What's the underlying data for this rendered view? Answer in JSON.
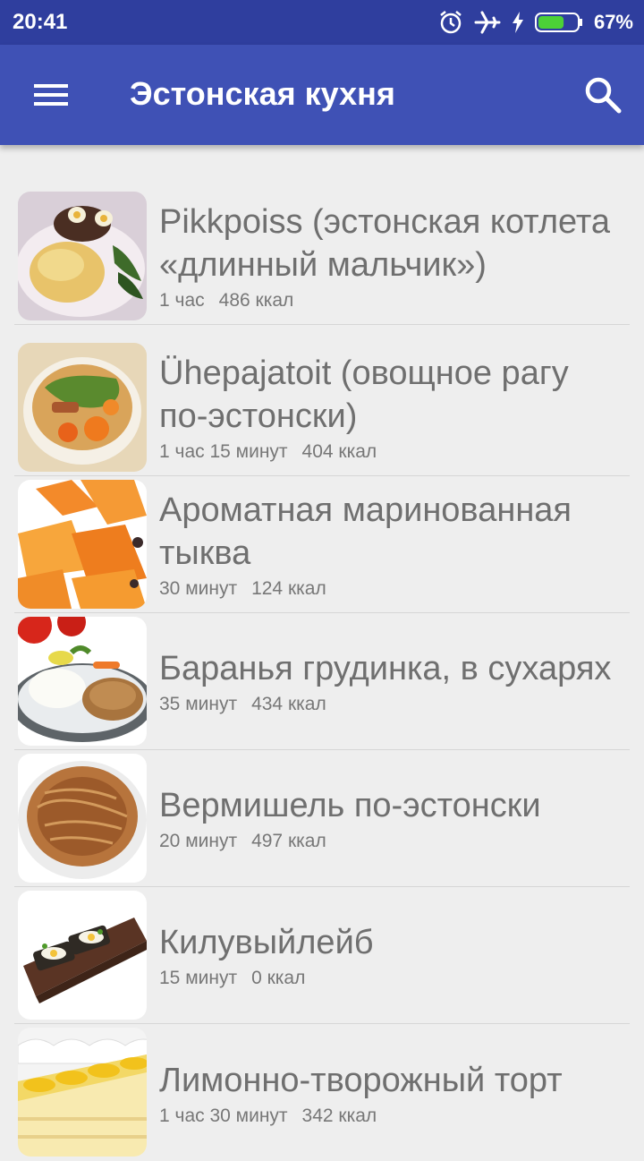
{
  "status": {
    "time": "20:41",
    "battery_pct": "67%",
    "battery_level": 0.67
  },
  "appbar": {
    "title": "Эстонская кухня",
    "menu_icon": "menu-icon",
    "search_icon": "search-icon"
  },
  "recipes": [
    {
      "name": "Pikkpoiss (эстонская котлета «длинный мальчик»)",
      "time": "1 час",
      "kcal": "486 ккал"
    },
    {
      "name": "Ühepajatoit (овощное рагу по-эстонски)",
      "time": "1 час 15 минут",
      "kcal": "404 ккал"
    },
    {
      "name": "Ароматная маринованная тыква",
      "time": "30 минут",
      "kcal": "124 ккал"
    },
    {
      "name": "Баранья грудинка, в сухарях",
      "time": "35 минут",
      "kcal": "434 ккал"
    },
    {
      "name": "Вермишель по-эстонски",
      "time": "20 минут",
      "kcal": "497 ккал"
    },
    {
      "name": "Килувыйлейб",
      "time": "15 минут",
      "kcal": "0 ккал"
    },
    {
      "name": "Лимонно-творожный торт",
      "time": "1 час 30 минут",
      "kcal": "342 ккал"
    }
  ]
}
